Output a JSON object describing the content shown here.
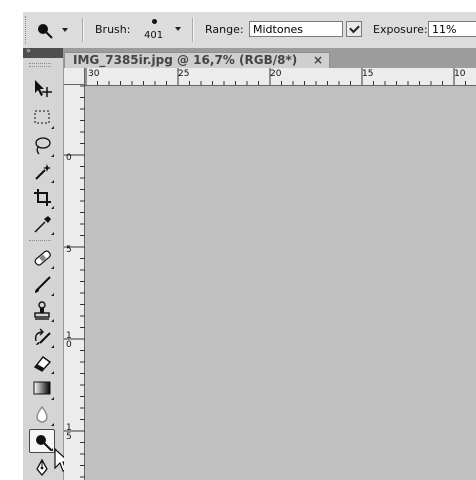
{
  "options_bar": {
    "brush_label": "Brush:",
    "brush_size": "401",
    "range_label": "Range:",
    "range_value": "Midtones",
    "exposure_label": "Exposure:",
    "exposure_value": "11%"
  },
  "document": {
    "tab_title": "IMG_7385ir.jpg @ 16,7% (RGB/8*)",
    "close_glyph": "×"
  },
  "rulers": {
    "horizontal": [
      "30",
      "25",
      "20",
      "15",
      "10"
    ],
    "vertical": [
      "0",
      "5",
      "1\n0",
      "1\n5"
    ]
  },
  "toolbox": {
    "header_glyph": "»",
    "tools": [
      "move-tool",
      "marquee-tool",
      "lasso-tool",
      "magic-wand-tool",
      "crop-tool",
      "eyedropper-tool",
      "spot-healing-tool",
      "brush-tool",
      "clone-stamp-tool",
      "history-brush-tool",
      "eraser-tool",
      "gradient-tool",
      "blur-tool",
      "dodge-tool",
      "pen-tool"
    ],
    "selected": "dodge-tool"
  },
  "colors": {
    "canvas": "#c0c0c0",
    "toolbar": "#dcdcdc",
    "panel": "#d5d5d5"
  }
}
